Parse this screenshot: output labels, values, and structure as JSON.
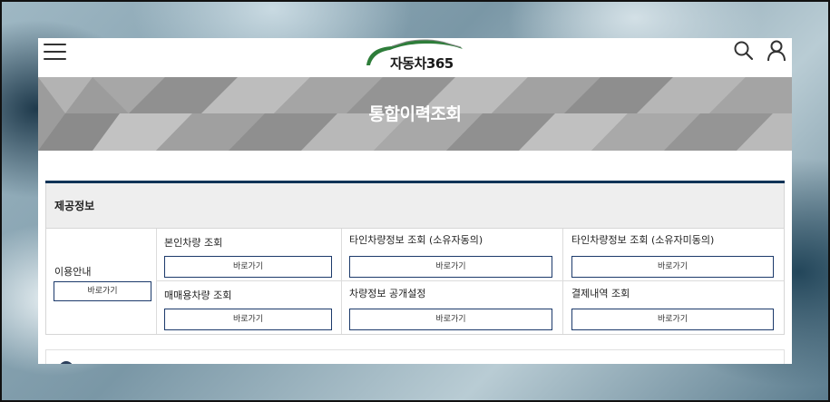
{
  "header": {
    "logo_text": "자동차365",
    "menu_icon": "hamburger-menu-icon",
    "search_icon": "search-icon",
    "user_icon": "user-icon"
  },
  "banner": {
    "title": "통합이력조회"
  },
  "provided_info": {
    "heading": "제공정보",
    "usage_guide": {
      "label": "이용안내",
      "button": "바로가기"
    },
    "items": [
      {
        "label": "본인차량 조회",
        "button": "바로가기"
      },
      {
        "label": "타인차량정보 조회 (소유자동의)",
        "button": "바로가기"
      },
      {
        "label": "타인차량정보 조회 (소유자미동의)",
        "button": "바로가기"
      },
      {
        "label": "매매용차량 조회",
        "button": "바로가기"
      },
      {
        "label": "차량정보 공개설정",
        "button": "바로가기"
      },
      {
        "label": "결제내역 조회",
        "button": "바로가기"
      }
    ]
  },
  "colors": {
    "accent_navy": "#0e3357",
    "button_border": "#1c3a6b",
    "logo_green": "#2e7d3a"
  }
}
